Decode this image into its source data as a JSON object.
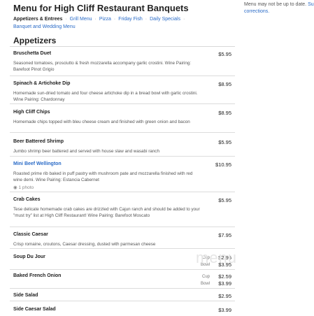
{
  "header": {
    "title": "Menu for High Cliff Restaurant Banquets",
    "notice_text": "Menu may not be up to date.",
    "notice_link": "Su corrections."
  },
  "nav": {
    "items": [
      {
        "label": "Appetizers & Entrees",
        "active": true
      },
      {
        "label": "Grill Menu"
      },
      {
        "label": "Pizza"
      },
      {
        "label": "Friday Fish"
      },
      {
        "label": "Daily Specials"
      },
      {
        "label": "Banquet and Wedding Menu"
      }
    ],
    "separator": "·"
  },
  "section": {
    "title": "Appetizers"
  },
  "items": [
    {
      "name": "Bruschetta Duet",
      "price": "$5.95",
      "desc": "Seasoned tomatoes, prosciutto & fresh mozzarella accompany garlic crostini. Wine Pairing: Barefoot Pinot Grigio"
    },
    {
      "name": "Spinach & Artichoke Dip",
      "price": "$8.95",
      "desc": "Homemade sun-dried tomato and four cheese artichoke dip in a bread bowl with garlic crostini. Wine Pairing: Chardonnay"
    },
    {
      "name": "High Cliff Chips",
      "price": "$8.95",
      "desc": "Homemade chips topped with bleu cheese cream and finished with green onion and bacon"
    },
    {
      "name": "Beer Battered Shrimp",
      "price": "$5.95",
      "desc": "Jumbo shrimp beer battered and served with house slaw and wasabi ranch"
    },
    {
      "name": "Mini Beef Wellington",
      "price": "$10.95",
      "desc": "Roasted prime rib baked in puff pastry with mushroom pate and mozzarella finished with red wine demi. Wine Pairing: Estancia Cabernet",
      "photo": "1 photo"
    },
    {
      "name": "Crab Cakes",
      "price": "$5.95",
      "desc": "Tese delicate homemade crab cakes are drizzled with Cajun ranch and should be added to your \"must try\" list at High Cliff Restaurant! Wine Pairing: Barefoot Moscato"
    },
    {
      "name": "Classic Caesar",
      "price": "$7.95",
      "desc": "Crisp romaine, croutons, Caesar dressing, dusted with parmesan cheese"
    },
    {
      "name": "Soup Du Jour",
      "labels": [
        "Cup",
        "Bowl"
      ],
      "prices": [
        "$2.95",
        "$3.95"
      ]
    },
    {
      "name": "Baked French Onion",
      "labels": [
        "Cup",
        "Bowl"
      ],
      "prices": [
        "$2.59",
        "$3.99"
      ]
    },
    {
      "name": "Side Salad",
      "price": "$2.95"
    },
    {
      "name": "Side Caesar Salad",
      "price": "$3.99"
    }
  ],
  "watermark": "menu"
}
